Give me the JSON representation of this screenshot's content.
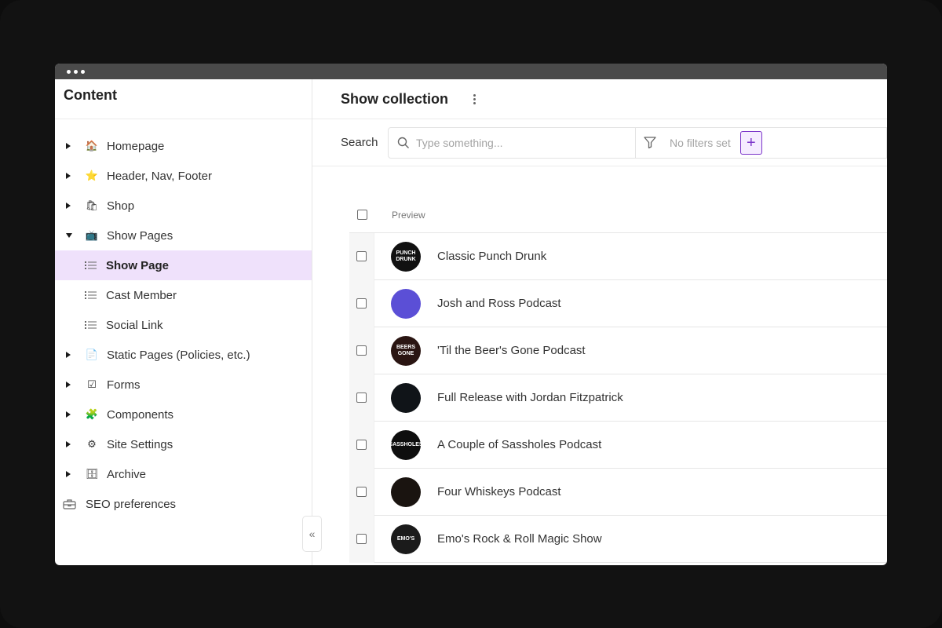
{
  "sidebar": {
    "title": "Content",
    "items": [
      {
        "label": "Homepage",
        "emoji": "🏠",
        "expanded": false
      },
      {
        "label": "Header, Nav, Footer",
        "emoji": "⭐",
        "expanded": false
      },
      {
        "label": "Shop",
        "emoji": "🛍",
        "expanded": false
      },
      {
        "label": "Show Pages",
        "emoji": "📺",
        "expanded": true
      },
      {
        "label": "Show Page",
        "child": true,
        "selected": true
      },
      {
        "label": "Cast Member",
        "child": true
      },
      {
        "label": "Social Link",
        "child": true
      },
      {
        "label": "Static Pages (Policies, etc.)",
        "emoji": "📄",
        "expanded": false
      },
      {
        "label": "Forms",
        "emoji": "☑",
        "expanded": false
      },
      {
        "label": "Components",
        "emoji": "🧩",
        "expanded": false
      },
      {
        "label": "Site Settings",
        "emoji": "⚙",
        "expanded": false
      },
      {
        "label": "Archive",
        "emoji": "🗄",
        "expanded": false
      },
      {
        "label": "SEO preferences",
        "icon": "toolbox-icon"
      }
    ],
    "collapse_glyph": "«"
  },
  "main": {
    "title": "Show collection",
    "search": {
      "label": "Search",
      "placeholder": "Type something...",
      "filter_text": "No filters set",
      "add_glyph": "+"
    },
    "table": {
      "column": "Preview",
      "rows": [
        {
          "title": "Classic Punch Drunk",
          "avatar_text": "PUNCH DRUNK",
          "avatar_bg": "#111111"
        },
        {
          "title": "Josh and Ross Podcast",
          "avatar_text": "",
          "avatar_bg": "#5b4fd6"
        },
        {
          "title": "'Til the Beer's Gone Podcast",
          "avatar_text": "BEERS GONE",
          "avatar_bg": "#2a1512"
        },
        {
          "title": "Full Release with Jordan Fitzpatrick",
          "avatar_text": "",
          "avatar_bg": "#101418"
        },
        {
          "title": "A Couple of Sassholes Podcast",
          "avatar_text": "SASSHOLES",
          "avatar_bg": "#0e0e0e"
        },
        {
          "title": "Four Whiskeys Podcast",
          "avatar_text": "",
          "avatar_bg": "#1a1410"
        },
        {
          "title": "Emo's Rock & Roll Magic Show",
          "avatar_text": "EMO'S",
          "avatar_bg": "#1b1b1b"
        }
      ]
    }
  },
  "colors": {
    "accent": "#7b35c9",
    "selected_bg": "#efe1fb",
    "titlebar": "#4a4a4a"
  }
}
